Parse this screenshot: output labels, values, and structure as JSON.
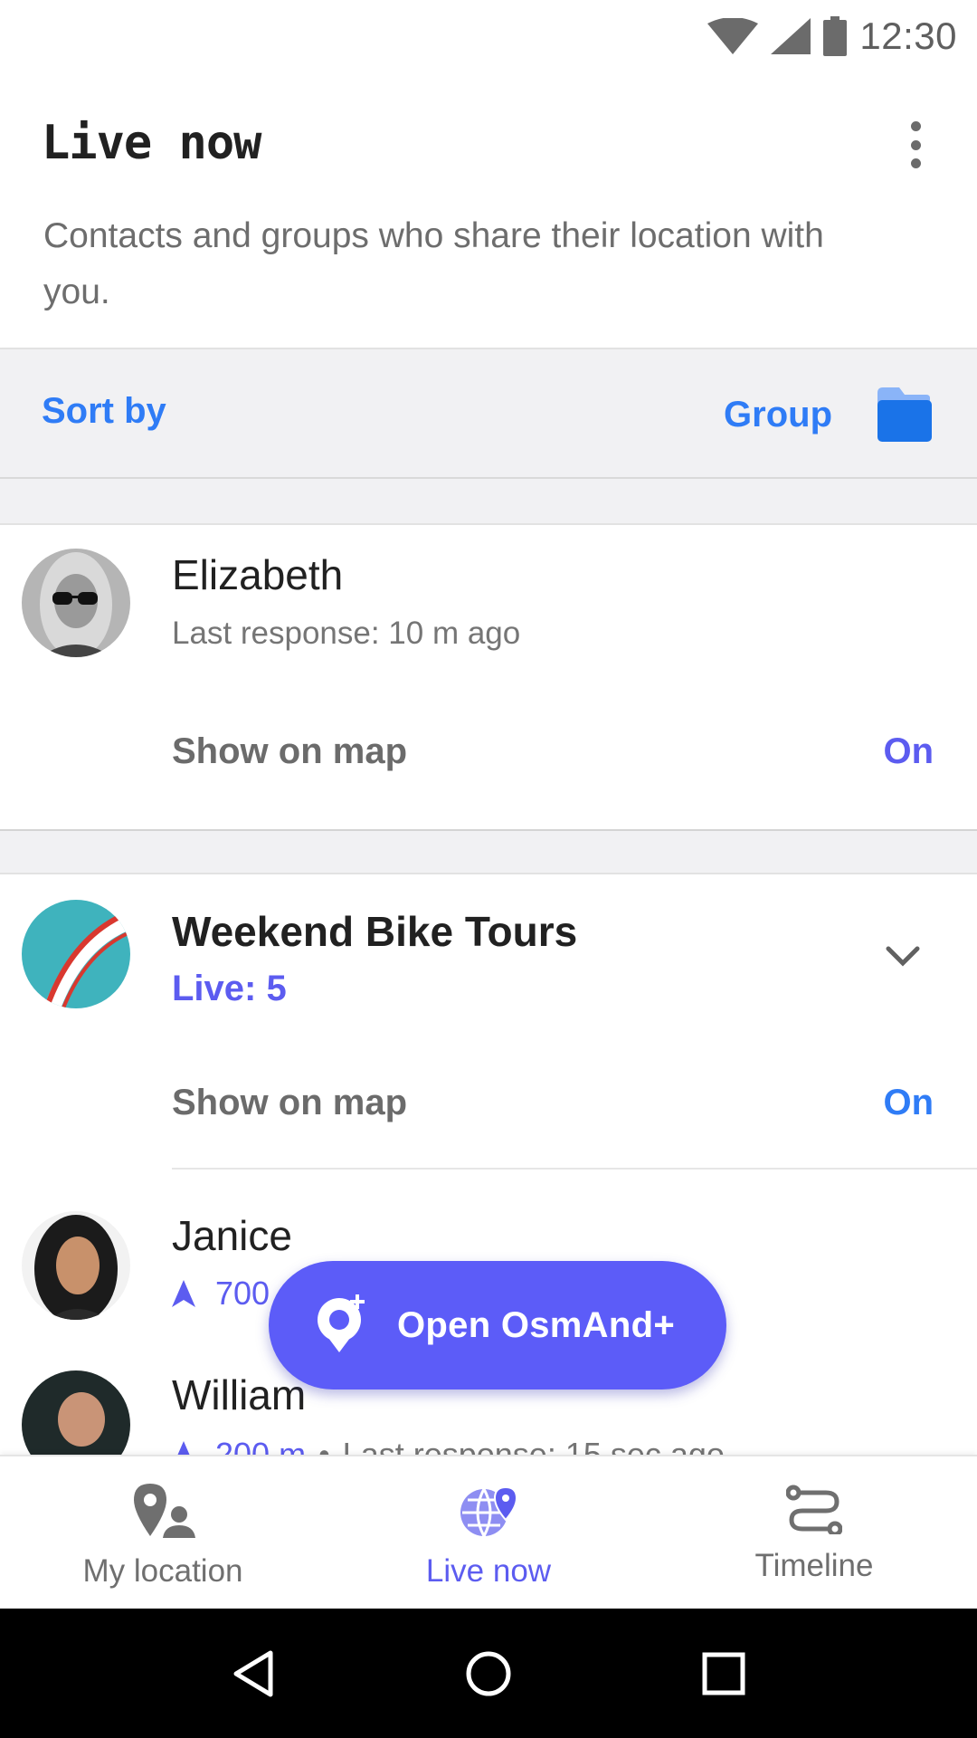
{
  "status_bar": {
    "time": "12:30",
    "icons": [
      "wifi-icon",
      "signal-icon",
      "battery-icon"
    ]
  },
  "header": {
    "title": "Live now",
    "description": "Contacts and groups who share their location with you.",
    "menu_icon": "more-vert-icon"
  },
  "sort_bar": {
    "sort_label": "Sort by",
    "group_label": "Group",
    "group_icon": "folder-icon"
  },
  "contacts": [
    {
      "name": "Elizabeth",
      "last_response": "Last response: 10 m ago",
      "show_on_map_label": "Show on map",
      "show_on_map_value": "On"
    }
  ],
  "group": {
    "name": "Weekend Bike Tours",
    "live": "Live: 5",
    "show_on_map_label": "Show on map",
    "show_on_map_value": "On",
    "members": [
      {
        "name": "Janice",
        "distance": "700"
      },
      {
        "name": "William",
        "distance": "200 m",
        "separator": "•",
        "last_response": "Last response: 15 sec ago"
      }
    ]
  },
  "fab": {
    "label": "Open OsmAnd+",
    "icon": "osmand-add-icon"
  },
  "bottom_nav": {
    "items": [
      {
        "label": "My location",
        "icon": "my-location-icon"
      },
      {
        "label": "Live now",
        "icon": "live-now-globe-icon"
      },
      {
        "label": "Timeline",
        "icon": "timeline-icon"
      }
    ],
    "active": "Live now"
  },
  "system_nav": {
    "buttons": [
      "back-icon",
      "home-icon",
      "recents-icon"
    ]
  },
  "colors": {
    "accent_blue": "#2f7cf6",
    "accent_purple": "#5c5cf0",
    "fab": "#5c5cf8",
    "sort_bar_bg": "#f1f1f3",
    "text_secondary": "#757575"
  }
}
